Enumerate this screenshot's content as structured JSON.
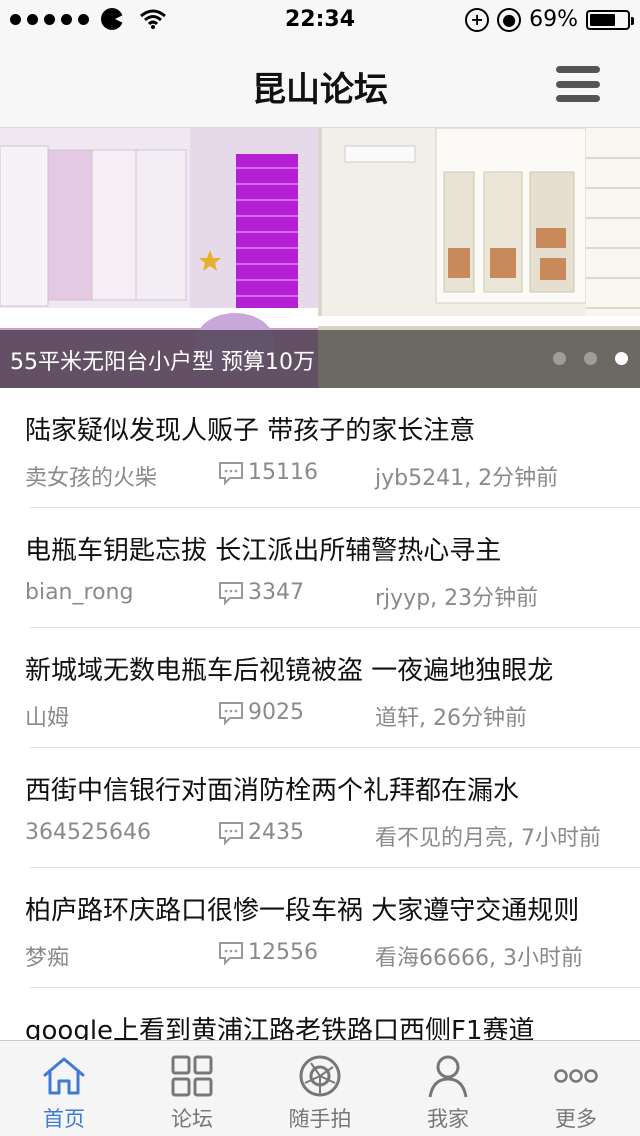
{
  "status_bar": {
    "time": "22:34",
    "battery": "69%",
    "battery_level": 0.69
  },
  "nav": {
    "title": "昆山论坛",
    "menu_icon": "hamburger-icon"
  },
  "banner": {
    "caption": "55平米无阳台小户型 预算10万",
    "page_count": 3,
    "active_page": 3
  },
  "threads": [
    {
      "title": "陆家疑似发现人贩子 带孩子的家长注意",
      "author": "卖女孩的火柴",
      "comments": "15116",
      "last_reply": "jyb5241, 2分钟前"
    },
    {
      "title": "电瓶车钥匙忘拔 长江派出所辅警热心寻主",
      "author": "bian_rong",
      "comments": "3347",
      "last_reply": "rjyyp, 23分钟前"
    },
    {
      "title": "新城域无数电瓶车后视镜被盗 一夜遍地独眼龙",
      "author": "山姆",
      "comments": "9025",
      "last_reply": "道轩, 26分钟前"
    },
    {
      "title": "西街中信银行对面消防栓两个礼拜都在漏水",
      "author": "364525646",
      "comments": "2435",
      "last_reply": "看不见的月亮, 7小时前"
    },
    {
      "title": "柏庐路环庆路口很惨一段车祸 大家遵守交通规则",
      "author": "梦痴",
      "comments": "12556",
      "last_reply": "看海66666, 3小时前"
    },
    {
      "title": "google上看到黄浦江路老铁路口西侧F1赛道",
      "author": "",
      "comments": "",
      "last_reply": ""
    }
  ],
  "tabs": [
    {
      "label": "首页",
      "icon": "home-icon",
      "active": true
    },
    {
      "label": "论坛",
      "icon": "grid-icon",
      "active": false
    },
    {
      "label": "随手拍",
      "icon": "camera-icon",
      "active": false
    },
    {
      "label": "我家",
      "icon": "person-icon",
      "active": false
    },
    {
      "label": "更多",
      "icon": "more-icon",
      "active": false
    }
  ],
  "colors": {
    "accent": "#3d7ad6",
    "muted": "#8a8a8a"
  }
}
